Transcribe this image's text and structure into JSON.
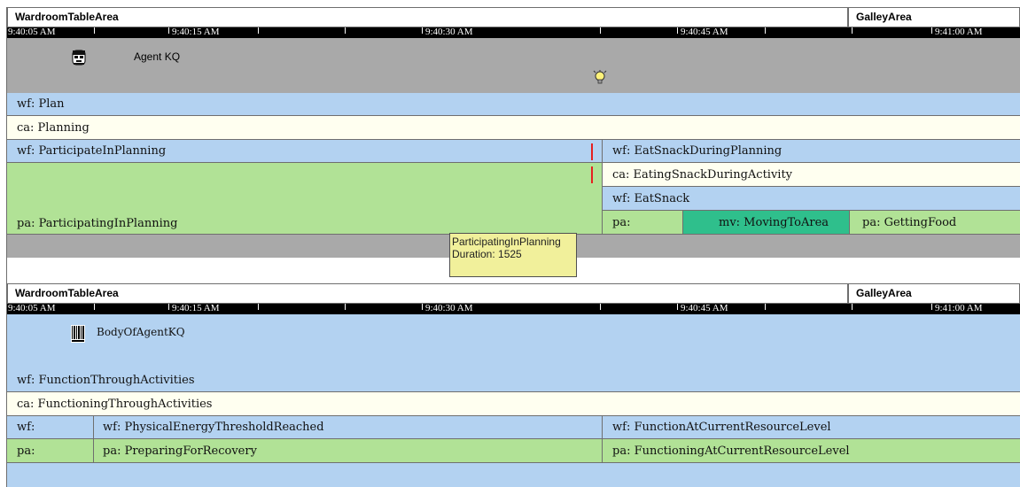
{
  "agent_panel": {
    "location_left": "WardroomTableArea",
    "location_right": "GalleyArea",
    "times": [
      "9:40:05 AM",
      "9:40:15 AM",
      "9:40:30 AM",
      "9:40:45 AM",
      "9:41:00 AM"
    ],
    "agent_name": "Agent KQ",
    "agent_icon": "person-face-icon",
    "event_icon": "lightbulb-icon",
    "rows": {
      "wf_plan": "wf: Plan",
      "ca_planning": "ca: Planning",
      "wf_participate": "wf: ParticipateInPlanning",
      "wf_eat_snack_during": "wf: EatSnackDuringPlanning",
      "ca_eating_snack": "ca: EatingSnackDuringActivity",
      "wf_eat_snack": "wf: EatSnack",
      "pa_participating": "pa: ParticipatingInPlanning",
      "pa_empty": "pa:",
      "mv_moving": "mv: MovingToArea",
      "pa_getting_food": "pa: GettingFood"
    },
    "tooltip": {
      "line1": "ParticipatingInPlanning",
      "line2": "Duration: 1525"
    },
    "marker_color": "#e52020"
  },
  "body_panel": {
    "location_left": "WardroomTableArea",
    "location_right": "GalleyArea",
    "times": [
      "9:40:05 AM",
      "9:40:15 AM",
      "9:40:30 AM",
      "9:40:45 AM",
      "9:41:00 AM"
    ],
    "body_name": "BodyOfAgentKQ",
    "body_icon": "barcode-icon",
    "rows": {
      "wf_function": "wf: FunctionThroughActivities",
      "ca_functioning": "ca: FunctioningThroughActivities",
      "wf_short": "wf:",
      "wf_threshold": "wf: PhysicalEnergyThresholdReached",
      "wf_function_current": "wf: FunctionAtCurrentResourceLevel",
      "pa_short": "pa:",
      "pa_preparing": "pa: PreparingForRecovery",
      "pa_functioning_current": "pa: FunctioningAtCurrentResourceLevel"
    }
  },
  "colors": {
    "wf": "#b3d2f1",
    "ca": "#fffff0",
    "pa": "#b1e296",
    "mv": "#2fbf8c",
    "agent_area": "#a9a9a9",
    "tooltip": "#f1f09b"
  }
}
